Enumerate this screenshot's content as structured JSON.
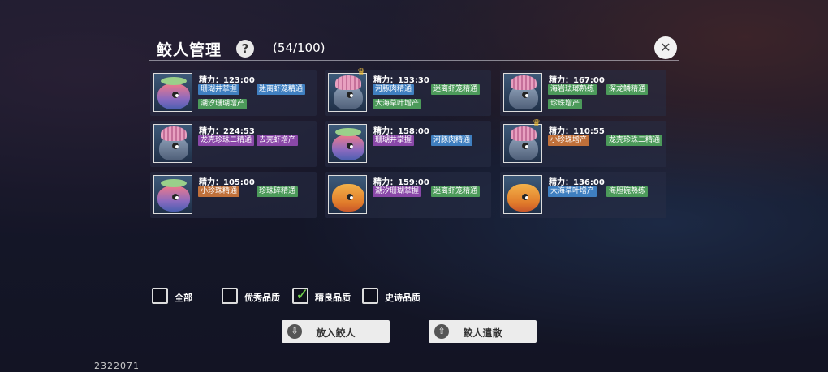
{
  "header": {
    "title": "鲛人管理",
    "help_symbol": "?",
    "count": "(54/100)",
    "close_symbol": "✕"
  },
  "cards": [
    {
      "fish": "rainbow",
      "crown": false,
      "energy": "精力：123:00",
      "tags": [
        {
          "text": "珊瑚井掌握",
          "color": "blue"
        },
        {
          "text": "迷离虾笼精通",
          "color": "blue"
        },
        {
          "text": "潮汐珊瑚增产",
          "color": "green"
        }
      ]
    },
    {
      "fish": "pink",
      "crown": true,
      "energy": "精力：133:30",
      "tags": [
        {
          "text": "河豚肉精通",
          "color": "blue"
        },
        {
          "text": "迷离虾笼精通",
          "color": "green"
        },
        {
          "text": "大海草叶增产",
          "color": "green"
        }
      ]
    },
    {
      "fish": "pink",
      "crown": false,
      "energy": "精力：167:00",
      "tags": [
        {
          "text": "海岩珐瑯熟练",
          "color": "green"
        },
        {
          "text": "深龙鳞精通",
          "color": "green"
        },
        {
          "text": "珍珠增产",
          "color": "green"
        }
      ]
    },
    {
      "fish": "pink",
      "crown": false,
      "energy": "精力：224:53",
      "tags": [
        {
          "text": "龙壳珍珠二精通",
          "color": "purple"
        },
        {
          "text": "去壳虾增产",
          "color": "purple"
        }
      ]
    },
    {
      "fish": "rainbow",
      "crown": false,
      "energy": "精力：158:00",
      "tags": [
        {
          "text": "珊瑚井掌握",
          "color": "purple"
        },
        {
          "text": "河豚肉精通",
          "color": "blue"
        }
      ]
    },
    {
      "fish": "pink",
      "crown": true,
      "energy": "精力：110:55",
      "tags": [
        {
          "text": "小珍珠增产",
          "color": "orange"
        },
        {
          "text": "龙壳珍珠二精通",
          "color": "green"
        }
      ]
    },
    {
      "fish": "rainbow",
      "crown": false,
      "energy": "精力：105:00",
      "tags": [
        {
          "text": "小珍珠精通",
          "color": "orange"
        },
        {
          "text": "珍珠碎精通",
          "color": "green"
        }
      ]
    },
    {
      "fish": "orange",
      "crown": false,
      "energy": "精力：159:00",
      "tags": [
        {
          "text": "潮汐珊瑚掌握",
          "color": "purple"
        },
        {
          "text": "迷离虾笼精通",
          "color": "green"
        }
      ]
    },
    {
      "fish": "orange",
      "crown": false,
      "energy": "精力：136:00",
      "tags": [
        {
          "text": "大海草叶增产",
          "color": "blue"
        },
        {
          "text": "海胆碗熟练",
          "color": "green"
        }
      ]
    }
  ],
  "filters": [
    {
      "label": "全部",
      "checked": false
    },
    {
      "label": "优秀品质",
      "checked": false
    },
    {
      "label": "精良品质",
      "checked": true
    },
    {
      "label": "史诗品质",
      "checked": false
    }
  ],
  "buttons": {
    "put_in": {
      "label": "放入鲛人",
      "icon": "⇩"
    },
    "dismiss": {
      "label": "鲛人遣散",
      "icon": "⇧"
    }
  },
  "uid": "2322071",
  "colors": {
    "tag_blue": "#3f7fc0",
    "tag_green": "#4c9a5a",
    "tag_purple": "#8a48a8",
    "tag_orange": "#c0703a",
    "check_green": "#6fd04a"
  }
}
